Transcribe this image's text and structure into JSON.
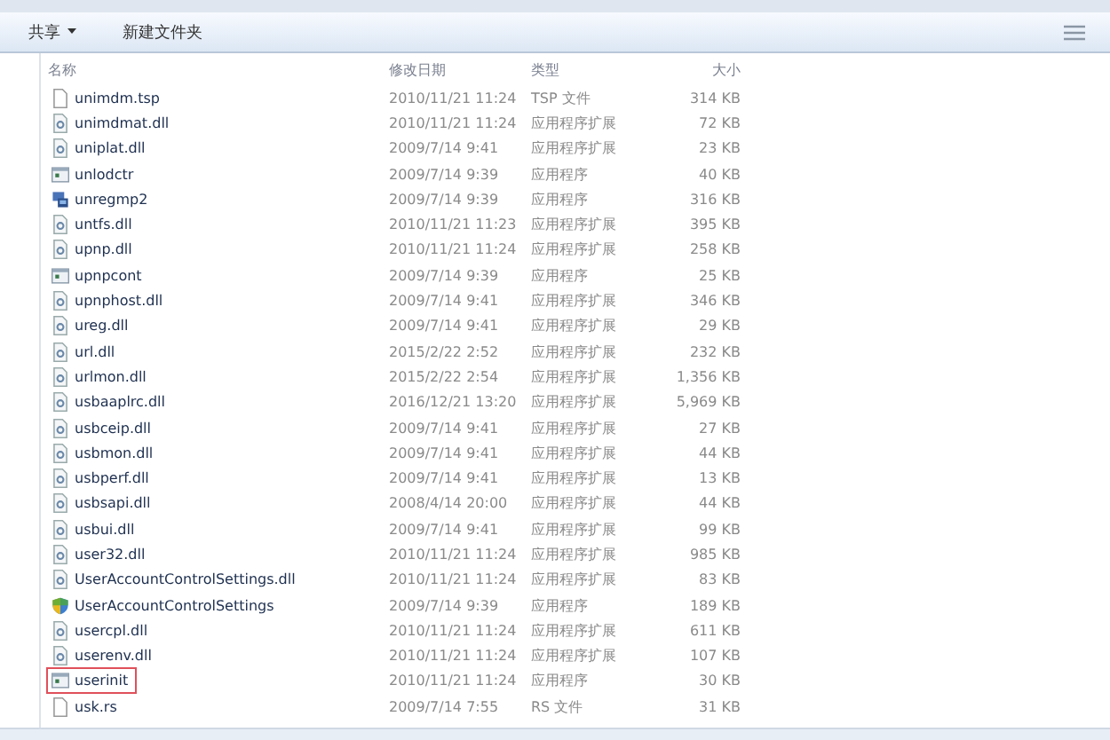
{
  "toolbar": {
    "buttons": [
      {
        "label": "共享",
        "dropdown": true
      },
      {
        "label": "新建文件夹",
        "dropdown": false
      }
    ]
  },
  "table": {
    "columns": [
      "名称",
      "修改日期",
      "类型",
      "大小"
    ],
    "rows": [
      {
        "name": "unimdm.tsp",
        "date": "2010/11/21 11:24",
        "type": "TSP 文件",
        "size": "314 KB",
        "kind": "file",
        "highlighted": false
      },
      {
        "name": "unimdmat.dll",
        "date": "2010/11/21 11:24",
        "type": "应用程序扩展",
        "size": "72 KB",
        "kind": "dll",
        "highlighted": false
      },
      {
        "name": "uniplat.dll",
        "date": "2009/7/14 9:41",
        "type": "应用程序扩展",
        "size": "23 KB",
        "kind": "dll",
        "highlighted": false
      },
      {
        "name": "unlodctr",
        "date": "2009/7/14 9:39",
        "type": "应用程序",
        "size": "40 KB",
        "kind": "exe",
        "highlighted": false
      },
      {
        "name": "unregmp2",
        "date": "2009/7/14 9:39",
        "type": "应用程序",
        "size": "316 KB",
        "kind": "setup",
        "highlighted": false
      },
      {
        "name": "untfs.dll",
        "date": "2010/11/21 11:23",
        "type": "应用程序扩展",
        "size": "395 KB",
        "kind": "dll",
        "highlighted": false
      },
      {
        "name": "upnp.dll",
        "date": "2010/11/21 11:24",
        "type": "应用程序扩展",
        "size": "258 KB",
        "kind": "dll",
        "highlighted": false
      },
      {
        "name": "upnpcont",
        "date": "2009/7/14 9:39",
        "type": "应用程序",
        "size": "25 KB",
        "kind": "exe",
        "highlighted": false
      },
      {
        "name": "upnphost.dll",
        "date": "2009/7/14 9:41",
        "type": "应用程序扩展",
        "size": "346 KB",
        "kind": "dll",
        "highlighted": false
      },
      {
        "name": "ureg.dll",
        "date": "2009/7/14 9:41",
        "type": "应用程序扩展",
        "size": "29 KB",
        "kind": "dll",
        "highlighted": false
      },
      {
        "name": "url.dll",
        "date": "2015/2/22 2:52",
        "type": "应用程序扩展",
        "size": "232 KB",
        "kind": "dll",
        "highlighted": false
      },
      {
        "name": "urlmon.dll",
        "date": "2015/2/22 2:54",
        "type": "应用程序扩展",
        "size": "1,356 KB",
        "kind": "dll",
        "highlighted": false
      },
      {
        "name": "usbaaplrc.dll",
        "date": "2016/12/21 13:20",
        "type": "应用程序扩展",
        "size": "5,969 KB",
        "kind": "dll",
        "highlighted": false
      },
      {
        "name": "usbceip.dll",
        "date": "2009/7/14 9:41",
        "type": "应用程序扩展",
        "size": "27 KB",
        "kind": "dll",
        "highlighted": false
      },
      {
        "name": "usbmon.dll",
        "date": "2009/7/14 9:41",
        "type": "应用程序扩展",
        "size": "44 KB",
        "kind": "dll",
        "highlighted": false
      },
      {
        "name": "usbperf.dll",
        "date": "2009/7/14 9:41",
        "type": "应用程序扩展",
        "size": "13 KB",
        "kind": "dll",
        "highlighted": false
      },
      {
        "name": "usbsapi.dll",
        "date": "2008/4/14 20:00",
        "type": "应用程序扩展",
        "size": "44 KB",
        "kind": "dll",
        "highlighted": false
      },
      {
        "name": "usbui.dll",
        "date": "2009/7/14 9:41",
        "type": "应用程序扩展",
        "size": "99 KB",
        "kind": "dll",
        "highlighted": false
      },
      {
        "name": "user32.dll",
        "date": "2010/11/21 11:24",
        "type": "应用程序扩展",
        "size": "985 KB",
        "kind": "dll",
        "highlighted": false
      },
      {
        "name": "UserAccountControlSettings.dll",
        "date": "2010/11/21 11:24",
        "type": "应用程序扩展",
        "size": "83 KB",
        "kind": "dll",
        "highlighted": false
      },
      {
        "name": "UserAccountControlSettings",
        "date": "2009/7/14 9:39",
        "type": "应用程序",
        "size": "189 KB",
        "kind": "shield",
        "highlighted": false
      },
      {
        "name": "usercpl.dll",
        "date": "2010/11/21 11:24",
        "type": "应用程序扩展",
        "size": "611 KB",
        "kind": "dll",
        "highlighted": false
      },
      {
        "name": "userenv.dll",
        "date": "2010/11/21 11:24",
        "type": "应用程序扩展",
        "size": "107 KB",
        "kind": "dll",
        "highlighted": false
      },
      {
        "name": "userinit",
        "date": "2010/11/21 11:24",
        "type": "应用程序",
        "size": "30 KB",
        "kind": "exe",
        "highlighted": true
      },
      {
        "name": "usk.rs",
        "date": "2009/7/14 7:55",
        "type": "RS 文件",
        "size": "31 KB",
        "kind": "file",
        "highlighted": false
      }
    ]
  }
}
